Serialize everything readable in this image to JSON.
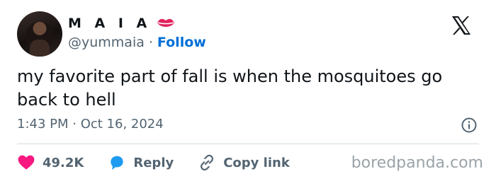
{
  "author": {
    "display_name": "M A I A",
    "handle": "@yummaia",
    "separator": "·",
    "follow_label": "Follow",
    "follow_color": "#006fd6"
  },
  "tweet": {
    "text": "my favorite part of fall is when the mosquitoes go back to hell",
    "timestamp": "1:43 PM · Oct 16, 2024"
  },
  "actions": {
    "likes": "49.2K",
    "reply_label": "Reply",
    "copy_label": "Copy link",
    "like_color": "#f91880",
    "reply_color": "#1d9bf0"
  },
  "watermark": "boredpanda.com",
  "icons": [
    "lips-icon",
    "x-logo-icon",
    "info-icon",
    "heart-icon",
    "reply-bubble-icon",
    "link-icon"
  ]
}
